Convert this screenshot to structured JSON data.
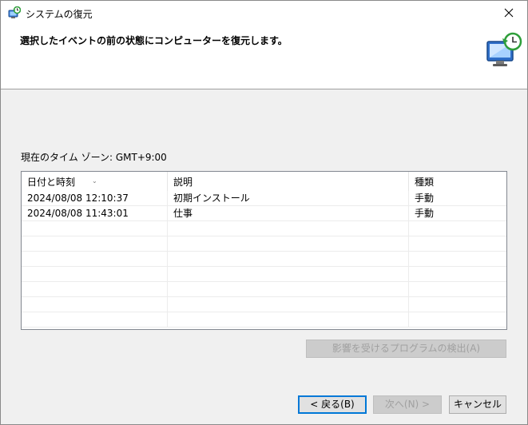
{
  "window": {
    "title": "システムの復元",
    "close_icon": "close-icon",
    "app_icon": "system-restore-icon"
  },
  "header": {
    "instruction": "選択したイベントの前の状態にコンピューターを復元します。",
    "icon": "restore-computer-icon"
  },
  "timezone_label": "現在のタイム ゾーン: GMT+9:00",
  "table": {
    "columns": [
      "日付と時刻",
      "説明",
      "種類"
    ],
    "sort_column": 0,
    "rows": [
      [
        "2024/08/08 12:10:37",
        "初期インストール",
        "手動"
      ],
      [
        "2024/08/08 11:43:01",
        "仕事",
        "手動"
      ]
    ],
    "empty_rows": 7
  },
  "buttons": {
    "detect_programs": "影響を受けるプログラムの検出(A)",
    "back": "< 戻る(B)",
    "next": "次へ(N) >",
    "cancel": "キャンセル"
  },
  "colors": {
    "accent": "#0078d7",
    "background": "#f0f0f0"
  }
}
